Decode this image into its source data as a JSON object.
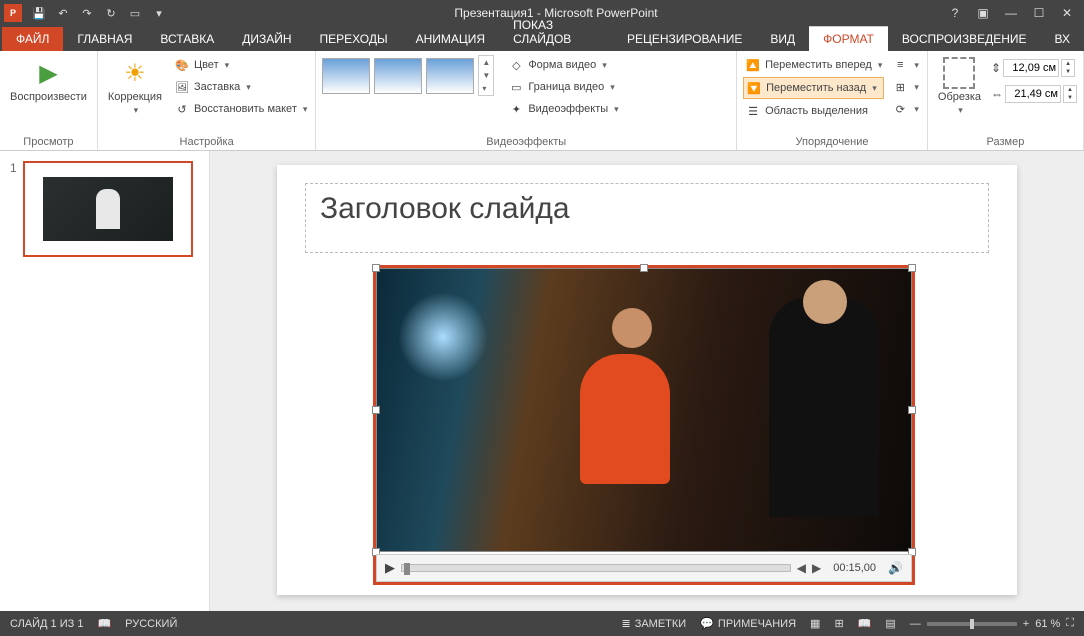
{
  "title": "Презентация1 - Microsoft PowerPoint",
  "tabs": {
    "file": "ФАЙЛ",
    "home": "ГЛАВНАЯ",
    "insert": "ВСТАВКА",
    "design": "ДИЗАЙН",
    "transitions": "ПЕРЕХОДЫ",
    "animations": "АНИМАЦИЯ",
    "slideshow": "ПОКАЗ СЛАЙДОВ",
    "review": "РЕЦЕНЗИРОВАНИЕ",
    "view": "ВИД",
    "format": "ФОРМАТ",
    "playback": "ВОСПРОИЗВЕДЕНИЕ",
    "overflow": "Вх"
  },
  "ribbon": {
    "preview": {
      "play": "Воспроизвести",
      "group": "Просмотр"
    },
    "adjust": {
      "corrections": "Коррекция",
      "color": "Цвет",
      "poster": "Заставка",
      "reset": "Восстановить макет",
      "group": "Настройка"
    },
    "videostyles": {
      "shape": "Форма видео",
      "border": "Граница видео",
      "effects": "Видеоэффекты",
      "group": "Видеоэффекты"
    },
    "arrange": {
      "forward": "Переместить вперед",
      "backward": "Переместить назад",
      "selection": "Область выделения",
      "group": "Упорядочение"
    },
    "size": {
      "crop": "Обрезка",
      "height": "12,09 см",
      "width": "21,49 см",
      "group": "Размер"
    }
  },
  "slide": {
    "number": "1",
    "titlePlaceholder": "Заголовок слайда",
    "video": {
      "time": "00:15,00"
    }
  },
  "status": {
    "slideCount": "СЛАЙД 1 ИЗ 1",
    "language": "РУССКИЙ",
    "notes": "ЗАМЕТКИ",
    "comments": "ПРИМЕЧАНИЯ",
    "zoom": "61 %"
  }
}
